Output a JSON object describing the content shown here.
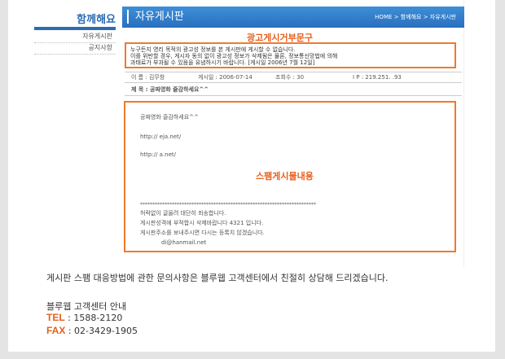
{
  "sidebar": {
    "title": "함께해요",
    "items": [
      "자유게시판",
      "공지사항"
    ]
  },
  "header": {
    "title": "자유게시판",
    "breadcrumb": "HOME > 함께해요 > 자유게시판"
  },
  "ad_notice": {
    "label": "광고게시거부문구",
    "lines": [
      "누구든지 영리 목적의 광고성 정보를 본 게시판에 게시할 수 없습니다.",
      "이를 위반할 경우, 게시자 동의 없이 광고성 정보가 삭제됨은 물론, 정보통신망법에 의해",
      "과태료가 부과될 수 있음을 유념하시기 바랍니다. [게시일 2006년 7월 12일]"
    ]
  },
  "post_info": {
    "name": "이 름 : 김무창",
    "date": "게시일 : 2006-07-14",
    "views": "조회수 : 30",
    "ip": "I P : 219.251.      .93",
    "subject": "제 목 : 공짜영화 즐감하세요^^"
  },
  "spam": {
    "label": "스팸게시물내용",
    "line1": "공짜영화 즐감하세요^^",
    "link1": "http://       eja.net/",
    "link2": "http://          a.net/",
    "stars": "************************************************************************",
    "footer1": "허락없이 글올려 대단히 죄송합니다.",
    "footer2": "게시판성격에 부적합시 삭제바랍니다 4321 입니다.",
    "footer3": "게시판주소를 보내주시면 다시는 등록치 않겠습니다.",
    "email": "di@hanmail.net"
  },
  "notice": "게시판 스팸 대응방법에 관한 문의사항은 블루웹 고객센터에서 친절히 상담해 드리겠습니다.",
  "contact": {
    "title": "블루웹 고객센터 안내",
    "tel_label": "TEL",
    "tel": " : 1588-2120",
    "fax_label": "FAX",
    "fax": " : 02-3429-1905"
  }
}
